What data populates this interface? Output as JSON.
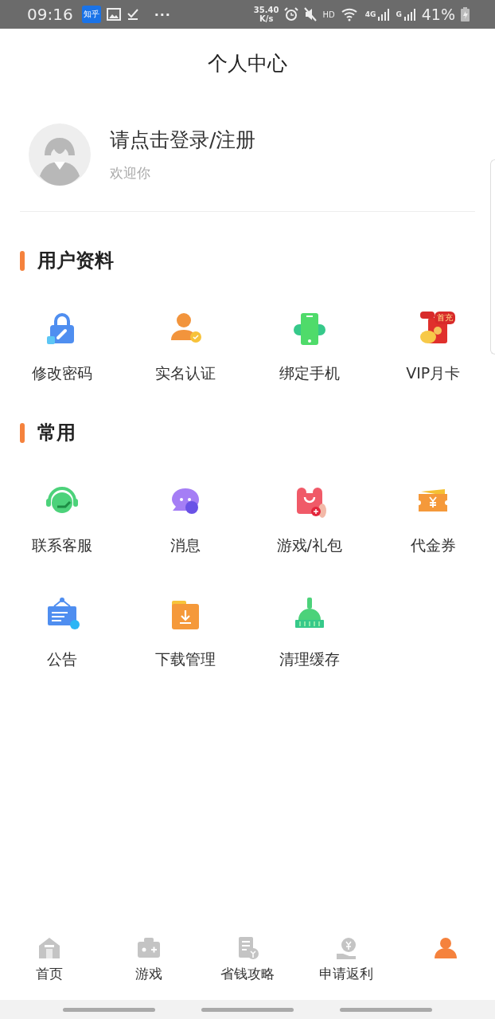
{
  "status_bar": {
    "time": "09:16",
    "app_badge": "知乎",
    "more": "···",
    "speed_value": "35.40",
    "speed_unit": "K/s",
    "hd": "HD",
    "network": "4G",
    "network_2": "G",
    "battery": "41%"
  },
  "header": {
    "title": "个人中心"
  },
  "profile": {
    "name": "请点击登录/注册",
    "subtitle": "欢迎你"
  },
  "sections": [
    {
      "title": "用户资料",
      "items": [
        {
          "label": "修改密码"
        },
        {
          "label": "实名认证"
        },
        {
          "label": "绑定手机"
        },
        {
          "label": "VIP月卡",
          "badge": "首充"
        }
      ]
    },
    {
      "title": "常用",
      "items": [
        {
          "label": "联系客服"
        },
        {
          "label": "消息"
        },
        {
          "label": "游戏/礼包"
        },
        {
          "label": "代金券"
        },
        {
          "label": "公告"
        },
        {
          "label": "下载管理"
        },
        {
          "label": "清理缓存"
        }
      ]
    }
  ],
  "bottom_nav": [
    {
      "label": "首页",
      "selected": false
    },
    {
      "label": "游戏",
      "selected": false
    },
    {
      "label": "省钱攻略",
      "selected": false
    },
    {
      "label": "申请返利",
      "selected": false
    },
    {
      "selected": true
    }
  ]
}
